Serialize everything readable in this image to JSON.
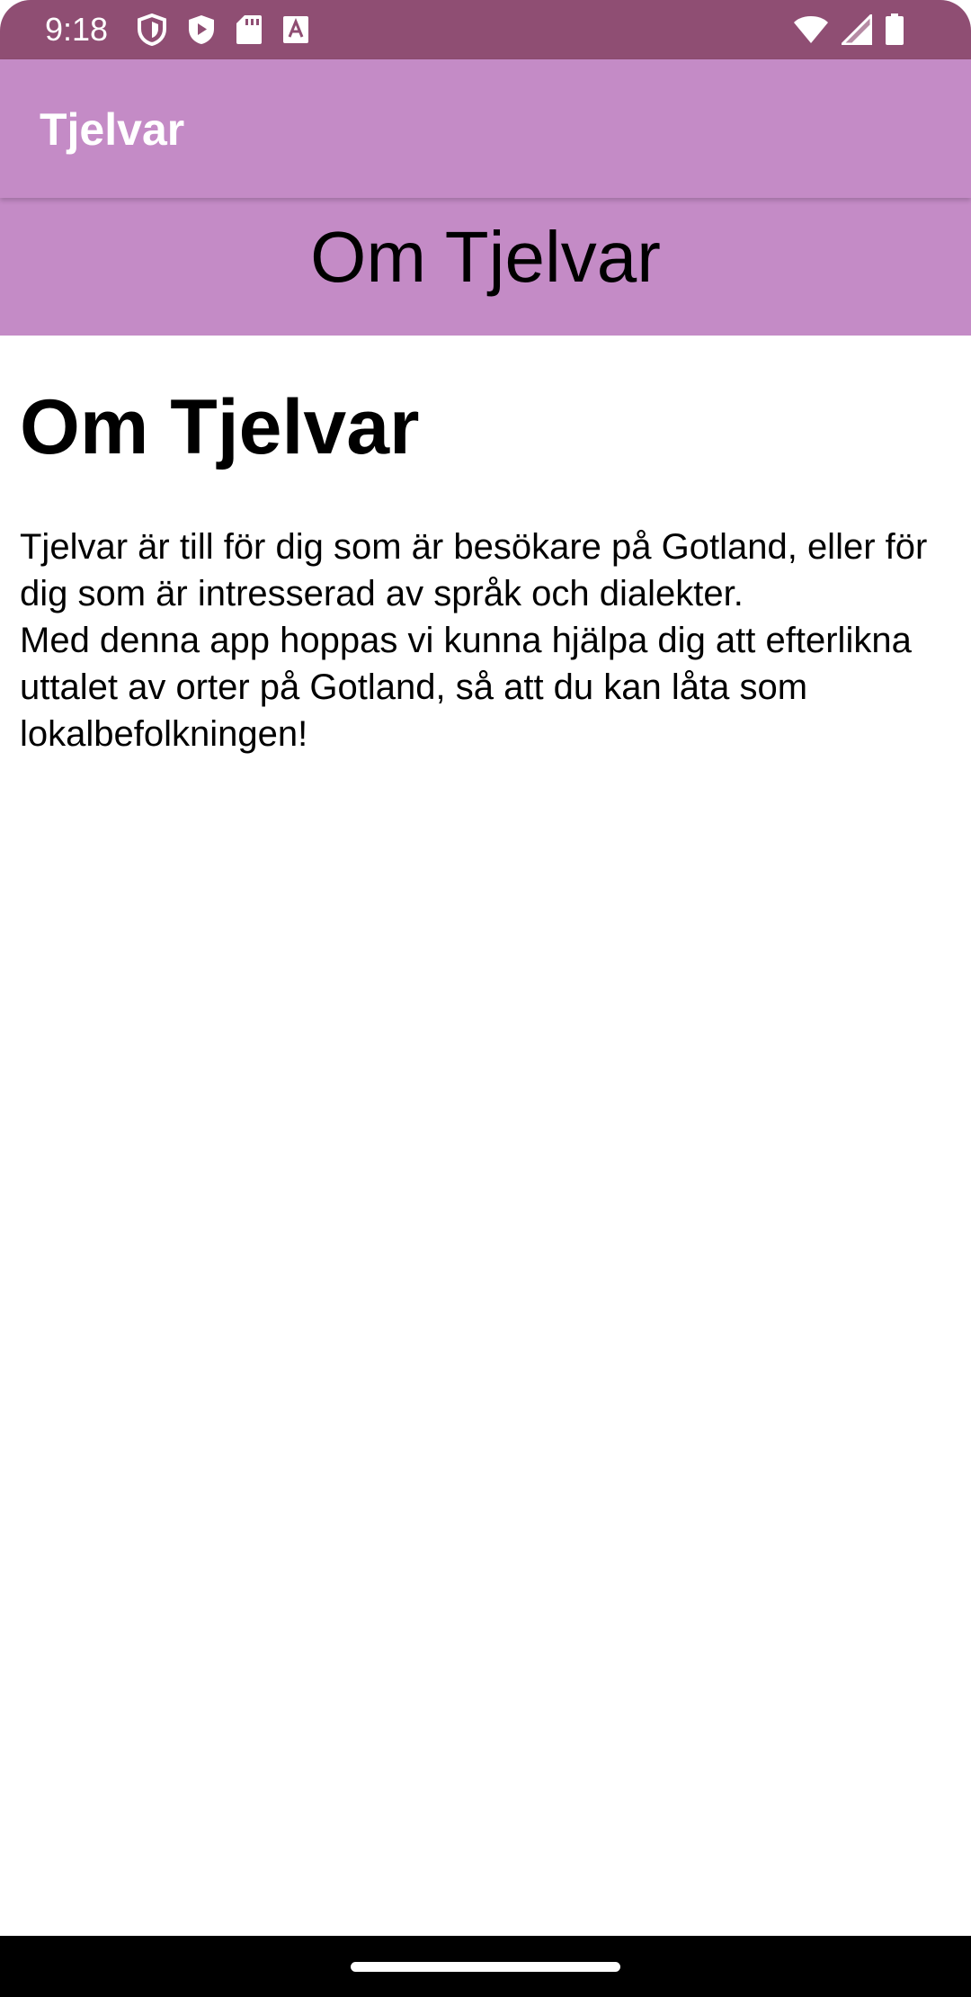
{
  "status_bar": {
    "time": "9:18",
    "background": "#8f4e73",
    "left_icons": [
      "shield-icon",
      "play-shield-icon",
      "sd-card-icon",
      "font-a-icon"
    ],
    "right_icons": [
      "wifi-icon",
      "signal-icon",
      "battery-icon"
    ]
  },
  "app_bar": {
    "title": "Tjelvar",
    "background": "#c48bc6"
  },
  "banner": {
    "title": "Om Tjelvar"
  },
  "content": {
    "heading": "Om Tjelvar",
    "paragraphs": [
      "Tjelvar är till för dig som är besökare på Gotland, eller för dig som är intresserad av språk och dialekter.",
      "Med denna app hoppas vi kunna hjälpa dig att efterlikna uttalet av orter på Gotland, så att du kan låta som lokalbefolkningen!"
    ]
  },
  "nav_bar": {
    "background": "#000000"
  }
}
